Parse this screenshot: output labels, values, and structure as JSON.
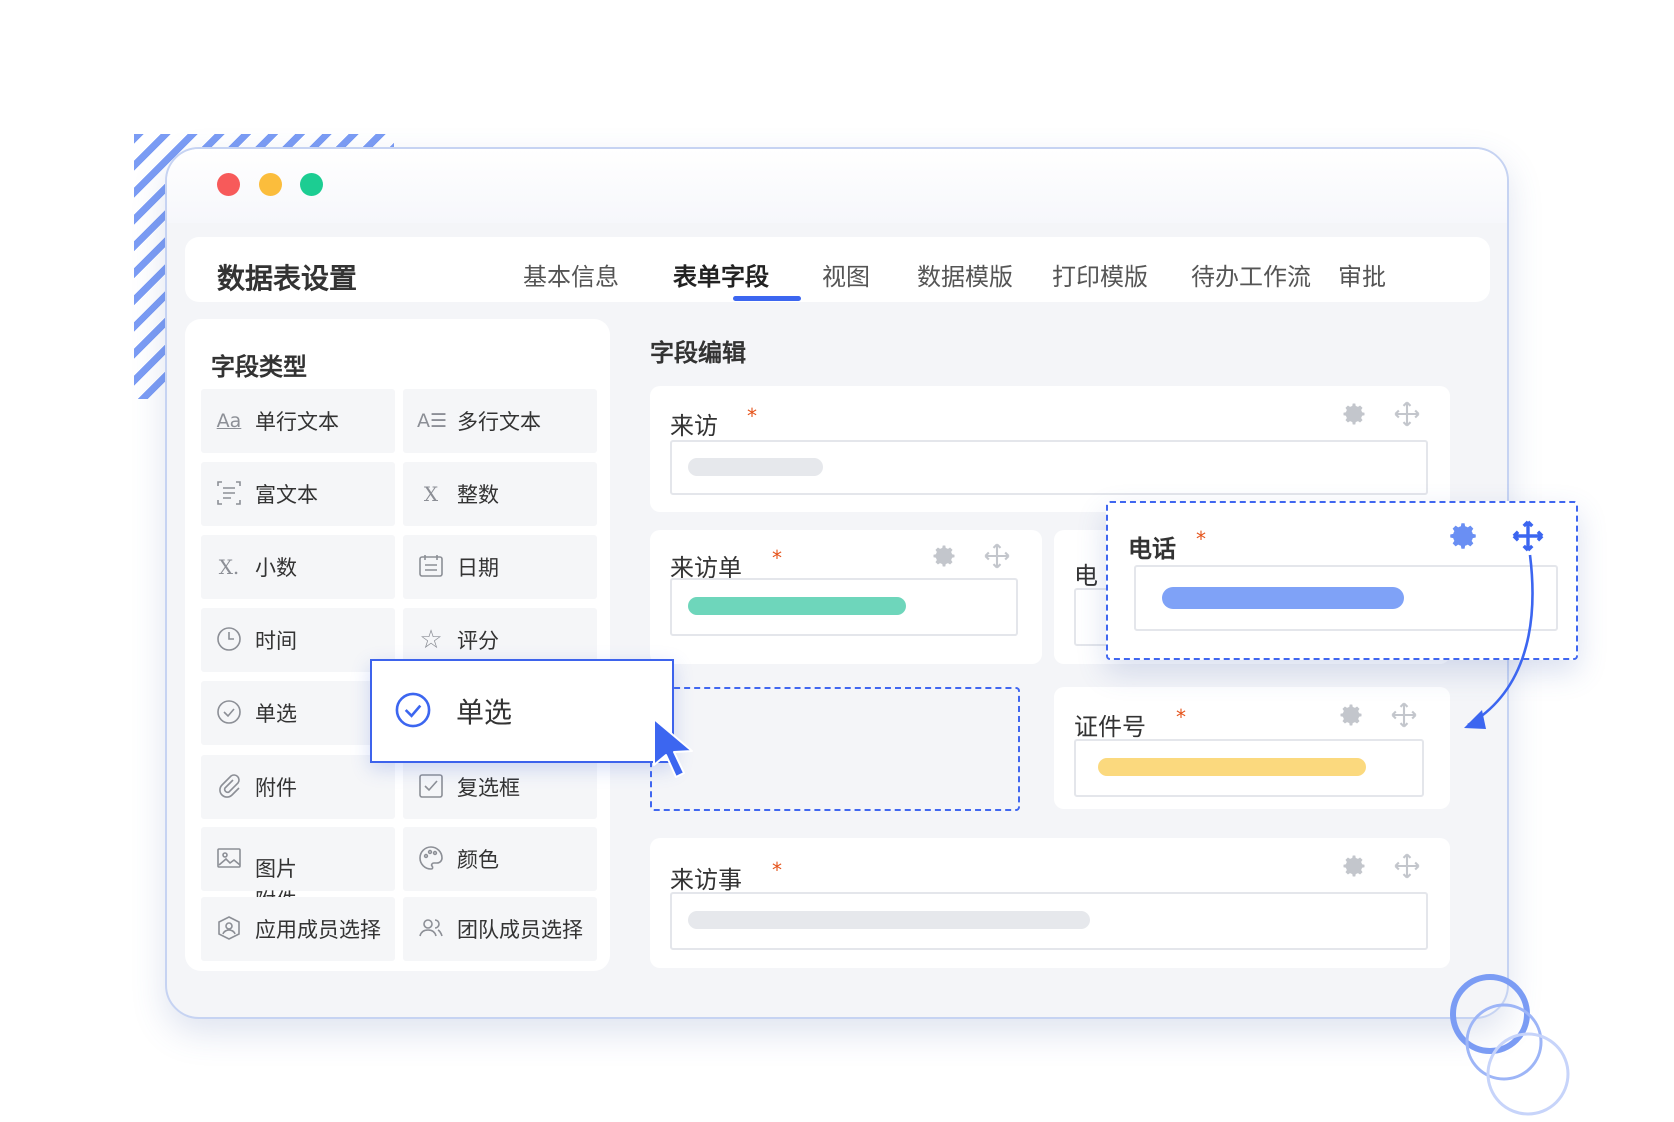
{
  "header": {
    "title": "数据表设置",
    "tabs": [
      "基本信息",
      "表单字段",
      "视图",
      "数据模版",
      "打印模版",
      "待办工作流",
      "审批"
    ],
    "active_tab": "表单字段"
  },
  "field_types": {
    "title": "字段类型",
    "items": [
      {
        "label": "单行文本",
        "icon": "single-line-text-icon"
      },
      {
        "label": "多行文本",
        "icon": "multi-line-text-icon"
      },
      {
        "label": "富文本",
        "icon": "rich-text-icon"
      },
      {
        "label": "整数",
        "icon": "integer-icon"
      },
      {
        "label": "小数",
        "icon": "decimal-icon"
      },
      {
        "label": "日期",
        "icon": "calendar-icon"
      },
      {
        "label": "时间",
        "icon": "clock-icon"
      },
      {
        "label": "评分",
        "icon": "star-icon"
      },
      {
        "label": "单选",
        "icon": "radio-check-icon"
      },
      {
        "label": "附件",
        "icon": "paperclip-icon"
      },
      {
        "label": "复选框",
        "icon": "checkbox-icon"
      },
      {
        "label": "图片附件",
        "icon": "image-icon"
      },
      {
        "label": "颜色",
        "icon": "palette-icon"
      },
      {
        "label": "应用成员选择",
        "icon": "member-icon"
      },
      {
        "label": "团队成员选择",
        "icon": "team-icon"
      }
    ]
  },
  "field_editor": {
    "title": "字段编辑",
    "fields": [
      {
        "label": "来访",
        "required": "*"
      },
      {
        "label": "来访单",
        "required": "*"
      },
      {
        "label": "电",
        "required": ""
      },
      {
        "label": "证件号",
        "required": "*"
      },
      {
        "label": "来访事",
        "required": "*"
      }
    ]
  },
  "dragging_field": {
    "label": "电话",
    "required": "*"
  },
  "dragging_type": {
    "label": "单选",
    "icon": "radio-check-icon"
  },
  "colors": {
    "accent": "#3c66f0",
    "required": "#e5531a",
    "bar_gray": "#e6e8ec",
    "bar_teal": "#6ed6bb",
    "bar_blue": "#7fa2f7",
    "bar_yellow": "#fbd97e"
  }
}
